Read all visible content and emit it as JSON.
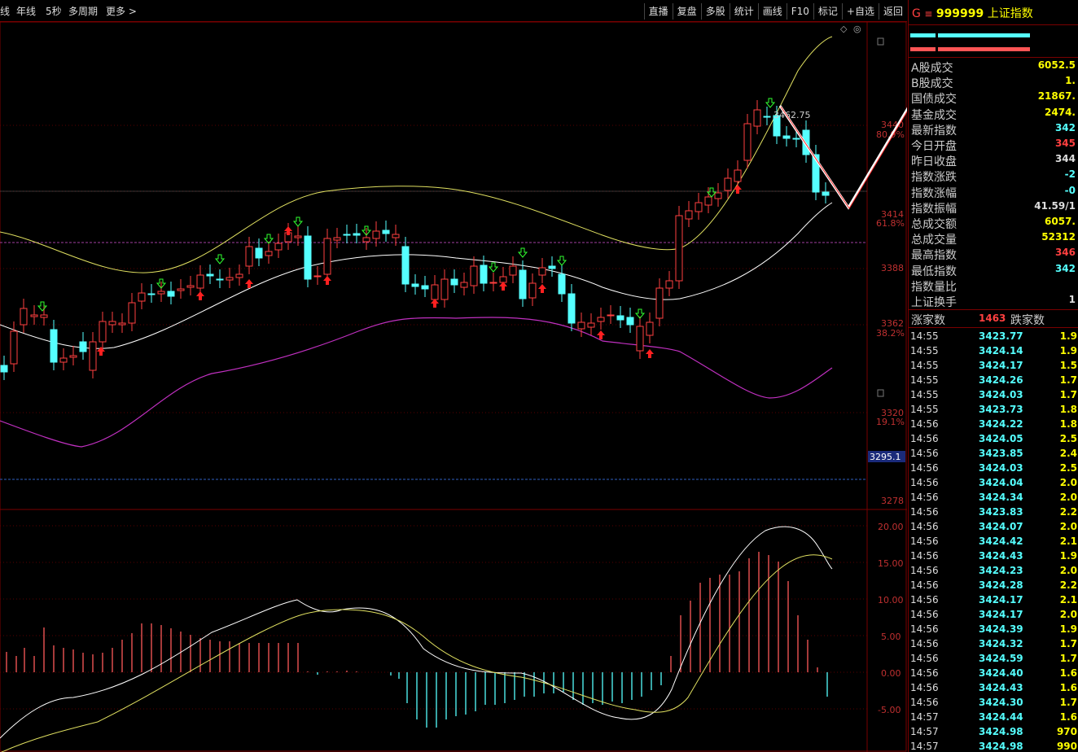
{
  "topbar": {
    "period_items": [
      "线",
      "年线",
      "5秒",
      "多周期",
      "更多 >"
    ],
    "toolbar": [
      "直播",
      "复盘",
      "多股",
      "统计",
      "画线",
      "F10",
      "标记",
      "+自选",
      "返回"
    ]
  },
  "chart_data": {
    "type": "candlestick",
    "main_y_labels": [
      "3440",
      "3414",
      "3388",
      "3362",
      "3320",
      "3278"
    ],
    "fib_labels": [
      "80.9%",
      "61.8%",
      "38.2%",
      "19.1%"
    ],
    "current_price_tag": "3295.1",
    "high_label": "3462.75",
    "macd_y_labels": [
      "20.00",
      "15.00",
      "10.00",
      "5.00",
      "0.00",
      "-5.00"
    ],
    "price_range": [
      3270,
      3490
    ],
    "macd_range": [
      -10,
      22
    ]
  },
  "right_panel": {
    "marker": "G",
    "code": "999999",
    "name": "上证指数",
    "stats": [
      {
        "label": "A股成交",
        "value": "6052.5",
        "color": "#ffff00"
      },
      {
        "label": "B股成交",
        "value": "1.",
        "color": "#ffff00"
      },
      {
        "label": "国债成交",
        "value": "21867.",
        "color": "#ffff00"
      },
      {
        "label": "基金成交",
        "value": "2474.",
        "color": "#ffff00"
      },
      {
        "label": "最新指数",
        "value": "342",
        "color": "#55ffff"
      },
      {
        "label": "今日开盘",
        "value": "345",
        "color": "#ff4040"
      },
      {
        "label": "昨日收盘",
        "value": "344",
        "color": "#dddddd"
      },
      {
        "label": "指数涨跌",
        "value": "-2",
        "color": "#55ffff"
      },
      {
        "label": "指数涨幅",
        "value": "-0",
        "color": "#55ffff"
      },
      {
        "label": "指数振幅",
        "value": "41.59/1",
        "color": "#dddddd"
      },
      {
        "label": "总成交额",
        "value": "6057.",
        "color": "#ffff00"
      },
      {
        "label": "总成交量",
        "value": "52312",
        "color": "#ffff00"
      },
      {
        "label": "最高指数",
        "value": "346",
        "color": "#ff4040"
      },
      {
        "label": "最低指数",
        "value": "342",
        "color": "#55ffff"
      },
      {
        "label": "指数量比",
        "value": "",
        "color": "#dddddd"
      },
      {
        "label": "上证换手",
        "value": "1",
        "color": "#dddddd"
      }
    ],
    "breadth": {
      "up_label": "涨家数",
      "up_value": "1463",
      "down_label": "跌家数"
    },
    "ticks": [
      {
        "time": "14:55",
        "price": "3423.77",
        "vol": "1.9"
      },
      {
        "time": "14:55",
        "price": "3424.14",
        "vol": "1.9"
      },
      {
        "time": "14:55",
        "price": "3424.17",
        "vol": "1.5"
      },
      {
        "time": "14:55",
        "price": "3424.26",
        "vol": "1.7"
      },
      {
        "time": "14:55",
        "price": "3424.03",
        "vol": "1.7"
      },
      {
        "time": "14:55",
        "price": "3423.73",
        "vol": "1.8"
      },
      {
        "time": "14:56",
        "price": "3424.22",
        "vol": "1.8"
      },
      {
        "time": "14:56",
        "price": "3424.05",
        "vol": "2.5"
      },
      {
        "time": "14:56",
        "price": "3423.85",
        "vol": "2.4"
      },
      {
        "time": "14:56",
        "price": "3424.03",
        "vol": "2.5"
      },
      {
        "time": "14:56",
        "price": "3424.04",
        "vol": "2.0"
      },
      {
        "time": "14:56",
        "price": "3424.34",
        "vol": "2.0"
      },
      {
        "time": "14:56",
        "price": "3423.83",
        "vol": "2.2"
      },
      {
        "time": "14:56",
        "price": "3424.07",
        "vol": "2.0"
      },
      {
        "time": "14:56",
        "price": "3424.42",
        "vol": "2.1"
      },
      {
        "time": "14:56",
        "price": "3424.43",
        "vol": "1.9"
      },
      {
        "time": "14:56",
        "price": "3424.23",
        "vol": "2.0"
      },
      {
        "time": "14:56",
        "price": "3424.28",
        "vol": "2.2"
      },
      {
        "time": "14:56",
        "price": "3424.17",
        "vol": "2.1"
      },
      {
        "time": "14:56",
        "price": "3424.17",
        "vol": "2.0"
      },
      {
        "time": "14:56",
        "price": "3424.39",
        "vol": "1.9"
      },
      {
        "time": "14:56",
        "price": "3424.32",
        "vol": "1.7"
      },
      {
        "time": "14:56",
        "price": "3424.59",
        "vol": "1.7"
      },
      {
        "time": "14:56",
        "price": "3424.40",
        "vol": "1.6"
      },
      {
        "time": "14:56",
        "price": "3424.43",
        "vol": "1.6"
      },
      {
        "time": "14:56",
        "price": "3424.30",
        "vol": "1.7"
      },
      {
        "time": "14:57",
        "price": "3424.44",
        "vol": "1.6"
      },
      {
        "time": "14:57",
        "price": "3424.98",
        "vol": "970"
      },
      {
        "time": "14:57",
        "price": "3424.98",
        "vol": "990"
      }
    ]
  }
}
